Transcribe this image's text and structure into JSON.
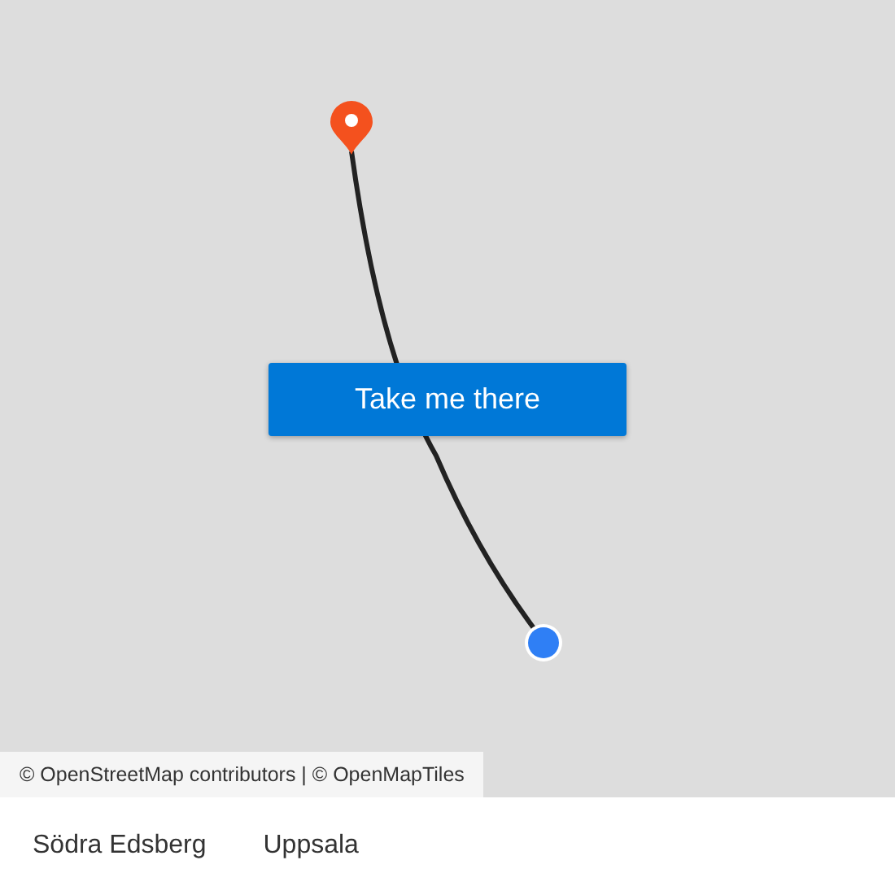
{
  "map": {
    "attribution": "© OpenStreetMap contributors | © OpenMapTiles",
    "action_button": "Take me there"
  },
  "route": {
    "from": "Södra Edsberg",
    "to": "Uppsala"
  }
}
